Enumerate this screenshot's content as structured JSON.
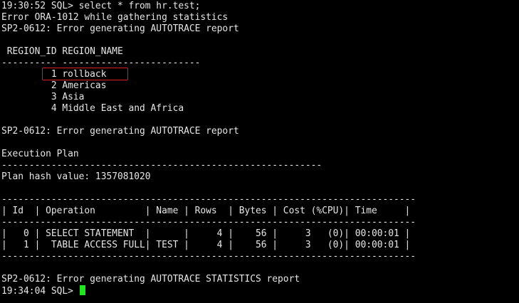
{
  "terminal": {
    "lines": [
      "19:30:52 SQL> select * from hr.test;",
      "Error ORA-1012 while gathering statistics",
      "SP2-0612: Error generating AUTOTRACE report",
      "",
      " REGION_ID REGION_NAME",
      "---------- -------------------------",
      "         1 rollback",
      "         2 Americas",
      "         3 Asia",
      "         4 Middle East and Africa",
      "",
      "SP2-0612: Error generating AUTOTRACE report",
      "",
      "Execution Plan",
      "----------------------------------------------------------",
      "Plan hash value: 1357081020",
      "",
      "---------------------------------------------------------------------------",
      "| Id  | Operation         | Name | Rows  | Bytes | Cost (%CPU)| Time     |",
      "---------------------------------------------------------------------------",
      "|   0 | SELECT STATEMENT  |      |     4 |    56 |     3   (0)| 00:00:01 |",
      "|   1 |  TABLE ACCESS FULL| TEST |     4 |    56 |     3   (0)| 00:00:01 |",
      "---------------------------------------------------------------------------",
      "",
      "SP2-0612: Error generating AUTOTRACE STATISTICS report"
    ],
    "prompt": "19:34:04 SQL> ",
    "colors": {
      "background": "#000000",
      "text": "#e6e6e6",
      "cursor": "#22e622",
      "highlight": "#e02020"
    }
  }
}
